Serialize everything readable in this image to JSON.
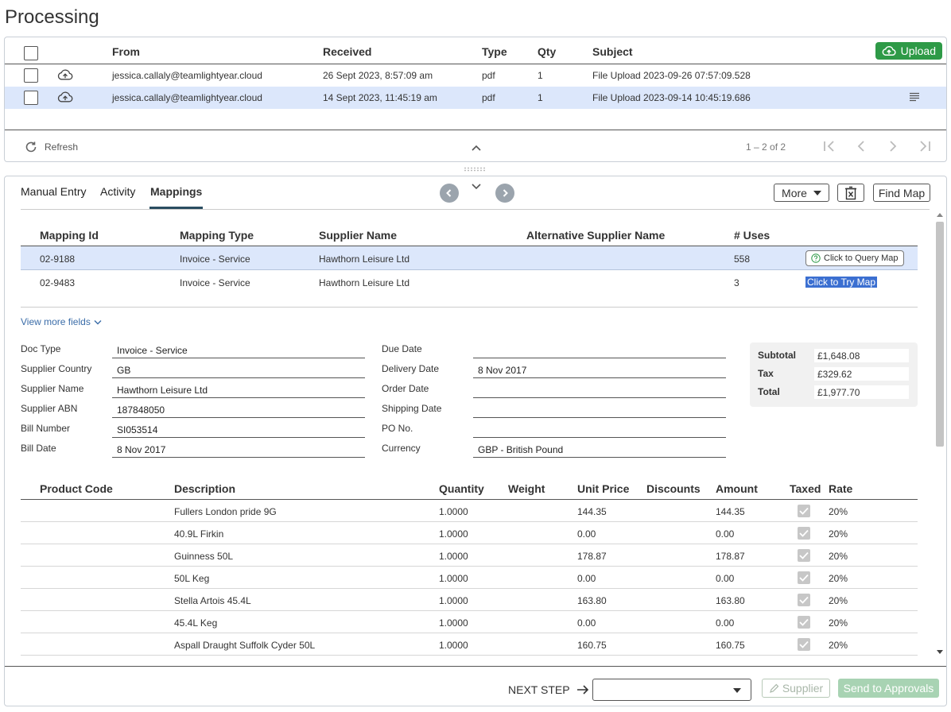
{
  "page": {
    "title": "Processing"
  },
  "inbox": {
    "headers": {
      "from": "From",
      "received": "Received",
      "type": "Type",
      "qty": "Qty",
      "subject": "Subject"
    },
    "upload_label": "Upload",
    "rows": [
      {
        "from": "jessica.callaly@teamlightyear.cloud",
        "received": "26 Sept 2023, 8:57:09 am",
        "type": "pdf",
        "qty": "1",
        "subject": "File Upload 2023-09-26 07:57:09.528",
        "selected": false
      },
      {
        "from": "jessica.callaly@teamlightyear.cloud",
        "received": "14 Sept 2023, 11:45:19 am",
        "type": "pdf",
        "qty": "1",
        "subject": "File Upload 2023-09-14 10:45:19.686",
        "selected": true
      }
    ],
    "refresh_label": "Refresh",
    "pager_text": "1 – 2 of 2"
  },
  "tabs": [
    {
      "label": "Manual Entry",
      "active": false
    },
    {
      "label": "Activity",
      "active": false
    },
    {
      "label": "Mappings",
      "active": true
    }
  ],
  "toolbar": {
    "more_label": "More",
    "find_map_label": "Find Map"
  },
  "mappings": {
    "headers": {
      "id": "Mapping Id",
      "type": "Mapping Type",
      "supplier": "Supplier Name",
      "alt_supplier": "Alternative Supplier Name",
      "uses": "# Uses"
    },
    "rows": [
      {
        "id": "02-9188",
        "type": "Invoice - Service",
        "supplier": "Hawthorn Leisure Ltd",
        "alt_supplier": "",
        "uses": "558",
        "action": "Click to Query Map"
      },
      {
        "id": "02-9483",
        "type": "Invoice - Service",
        "supplier": "Hawthorn Leisure Ltd",
        "alt_supplier": "",
        "uses": "3",
        "action": "Click to Try Map"
      }
    ]
  },
  "view_more_label": "View more fields",
  "fields_left": [
    {
      "label": "Doc Type",
      "value": "Invoice - Service"
    },
    {
      "label": "Supplier Country",
      "value": "GB"
    },
    {
      "label": "Supplier Name",
      "value": "Hawthorn Leisure Ltd"
    },
    {
      "label": "Supplier ABN",
      "value": "187848050"
    },
    {
      "label": "Bill Number",
      "value": "SI053514"
    },
    {
      "label": "Bill Date",
      "value": "8 Nov 2017"
    }
  ],
  "fields_right": [
    {
      "label": "Due Date",
      "value": ""
    },
    {
      "label": "Delivery Date",
      "value": "8 Nov 2017"
    },
    {
      "label": "Order Date",
      "value": ""
    },
    {
      "label": "Shipping Date",
      "value": ""
    },
    {
      "label": "PO No.",
      "value": ""
    },
    {
      "label": "Currency",
      "value": "GBP - British Pound"
    }
  ],
  "totals": [
    {
      "label": "Subtotal",
      "value": "£1,648.08"
    },
    {
      "label": "Tax",
      "value": "£329.62"
    },
    {
      "label": "Total",
      "value": "£1,977.70"
    }
  ],
  "line_items": {
    "headers": {
      "code": "Product Code",
      "description": "Description",
      "quantity": "Quantity",
      "weight": "Weight",
      "unit_price": "Unit Price",
      "discounts": "Discounts",
      "amount": "Amount",
      "taxed": "Taxed",
      "rate": "Rate"
    },
    "rows": [
      {
        "code": "",
        "description": "Fullers London pride 9G",
        "quantity": "1.0000",
        "weight": "",
        "unit_price": "144.35",
        "discounts": "",
        "amount": "144.35",
        "taxed": true,
        "rate": "20%"
      },
      {
        "code": "",
        "description": "40.9L Firkin",
        "quantity": "1.0000",
        "weight": "",
        "unit_price": "0.00",
        "discounts": "",
        "amount": "0.00",
        "taxed": true,
        "rate": "20%"
      },
      {
        "code": "",
        "description": "Guinness 50L",
        "quantity": "1.0000",
        "weight": "",
        "unit_price": "178.87",
        "discounts": "",
        "amount": "178.87",
        "taxed": true,
        "rate": "20%"
      },
      {
        "code": "",
        "description": "50L Keg",
        "quantity": "1.0000",
        "weight": "",
        "unit_price": "0.00",
        "discounts": "",
        "amount": "0.00",
        "taxed": true,
        "rate": "20%"
      },
      {
        "code": "",
        "description": "Stella Artois 45.4L",
        "quantity": "1.0000",
        "weight": "",
        "unit_price": "163.80",
        "discounts": "",
        "amount": "163.80",
        "taxed": true,
        "rate": "20%"
      },
      {
        "code": "",
        "description": "45.4L Keg",
        "quantity": "1.0000",
        "weight": "",
        "unit_price": "0.00",
        "discounts": "",
        "amount": "0.00",
        "taxed": true,
        "rate": "20%"
      },
      {
        "code": "",
        "description": "Aspall Draught Suffolk Cyder 50L",
        "quantity": "1.0000",
        "weight": "",
        "unit_price": "160.75",
        "discounts": "",
        "amount": "160.75",
        "taxed": true,
        "rate": "20%"
      }
    ]
  },
  "footer": {
    "next_step_label": "NEXT STEP",
    "next_step_value": "",
    "supplier_label": "Supplier",
    "send_label": "Send to Approvals"
  },
  "colors": {
    "accent_green": "#2e9a47",
    "selected_row": "#dce7fb",
    "link_blue": "#3a6ca8",
    "highlight_blue": "#3b6fd1"
  }
}
